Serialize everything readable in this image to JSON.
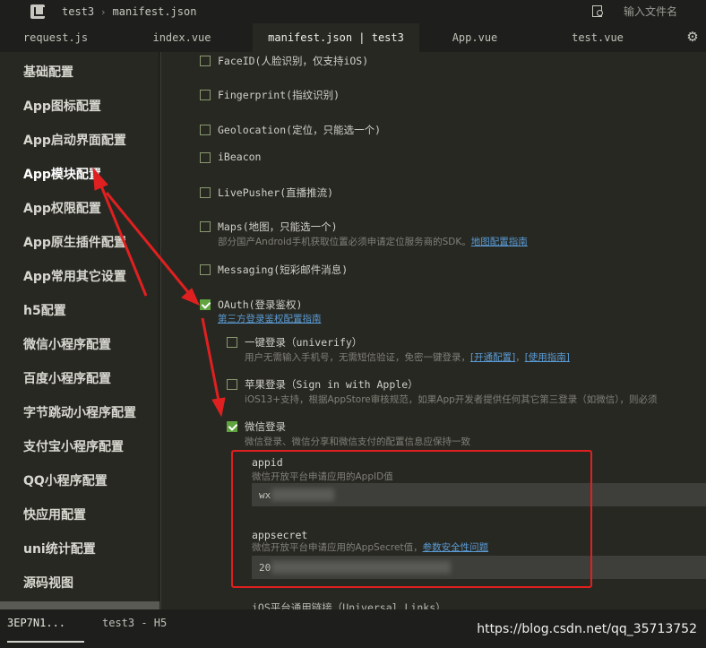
{
  "topbar": {
    "breadcrumb": [
      "test3",
      "manifest.json"
    ],
    "search_placeholder": "输入文件名"
  },
  "tabs": [
    {
      "label": "request.js",
      "active": false
    },
    {
      "label": "index.vue",
      "active": false
    },
    {
      "label": "manifest.json | test3",
      "active": true
    },
    {
      "label": "App.vue",
      "active": false
    },
    {
      "label": "test.vue",
      "active": false
    }
  ],
  "sidebar": {
    "items": [
      {
        "label": "基础配置"
      },
      {
        "label": "App图标配置"
      },
      {
        "label": "App启动界面配置"
      },
      {
        "label": "App模块配置",
        "active": true
      },
      {
        "label": "App权限配置"
      },
      {
        "label": "App原生插件配置"
      },
      {
        "label": "App常用其它设置"
      },
      {
        "label": "h5配置"
      },
      {
        "label": "微信小程序配置"
      },
      {
        "label": "百度小程序配置"
      },
      {
        "label": "字节跳动小程序配置"
      },
      {
        "label": "支付宝小程序配置"
      },
      {
        "label": "QQ小程序配置"
      },
      {
        "label": "快应用配置"
      },
      {
        "label": "uni统计配置"
      },
      {
        "label": "源码视图"
      }
    ]
  },
  "modules": {
    "faceid": {
      "label": "FaceID(人脸识别，仅支持iOS)",
      "checked": false
    },
    "fingerprint": {
      "label": "Fingerprint(指纹识别)",
      "checked": false
    },
    "geolocation": {
      "label": "Geolocation(定位，只能选一个)",
      "checked": false
    },
    "ibeacon": {
      "label": "iBeacon",
      "checked": false
    },
    "livepusher": {
      "label": "LivePusher(直播推流)",
      "checked": false
    },
    "maps": {
      "label": "Maps(地图，只能选一个)",
      "checked": false,
      "desc": "部分国产Android手机获取位置必须申请定位服务商的SDK。",
      "link": "地图配置指南"
    },
    "messaging": {
      "label": "Messaging(短彩邮件消息)",
      "checked": false
    },
    "oauth": {
      "label": "OAuth(登录鉴权)",
      "checked": true,
      "link": "第三方登录鉴权配置指南"
    },
    "univerify": {
      "label": "一键登录（univerify）",
      "checked": false,
      "desc": "用户无需输入手机号，无需短信验证，免密一键登录，",
      "link1": "[开通配置]",
      "sep": "，",
      "link2": "[使用指南]"
    },
    "apple": {
      "label": "苹果登录（Sign in with Apple）",
      "checked": false,
      "desc": "iOS13+支持，根据AppStore审核规范，如果App开发者提供任何其它第三登录（如微信），则必须"
    },
    "weixin": {
      "label": "微信登录",
      "checked": true,
      "desc": "微信登录、微信分享和微信支付的配置信息应保持一致"
    },
    "appid": {
      "title": "appid",
      "desc": "微信开放平台申请应用的AppID值",
      "value": "wx"
    },
    "appsecret": {
      "title": "appsecret",
      "desc": "微信开放平台申请应用的AppSecret值，",
      "link": "参数安全性问题",
      "value": "20"
    },
    "universal_links": {
      "label": "iOS平台通用链接（Universal Links）"
    }
  },
  "bottombar": {
    "tabs": [
      {
        "label": "3EP7N1...",
        "active": true
      },
      {
        "label": "test3 - H5",
        "active": false
      }
    ],
    "watermark": "https://blog.csdn.net/qq_35713752"
  },
  "colors": {
    "bg": "#272822",
    "bar": "#1e1f1c",
    "accent_green": "#5fa43f",
    "link": "#5b9bd5",
    "annotation_red": "#e02020"
  }
}
